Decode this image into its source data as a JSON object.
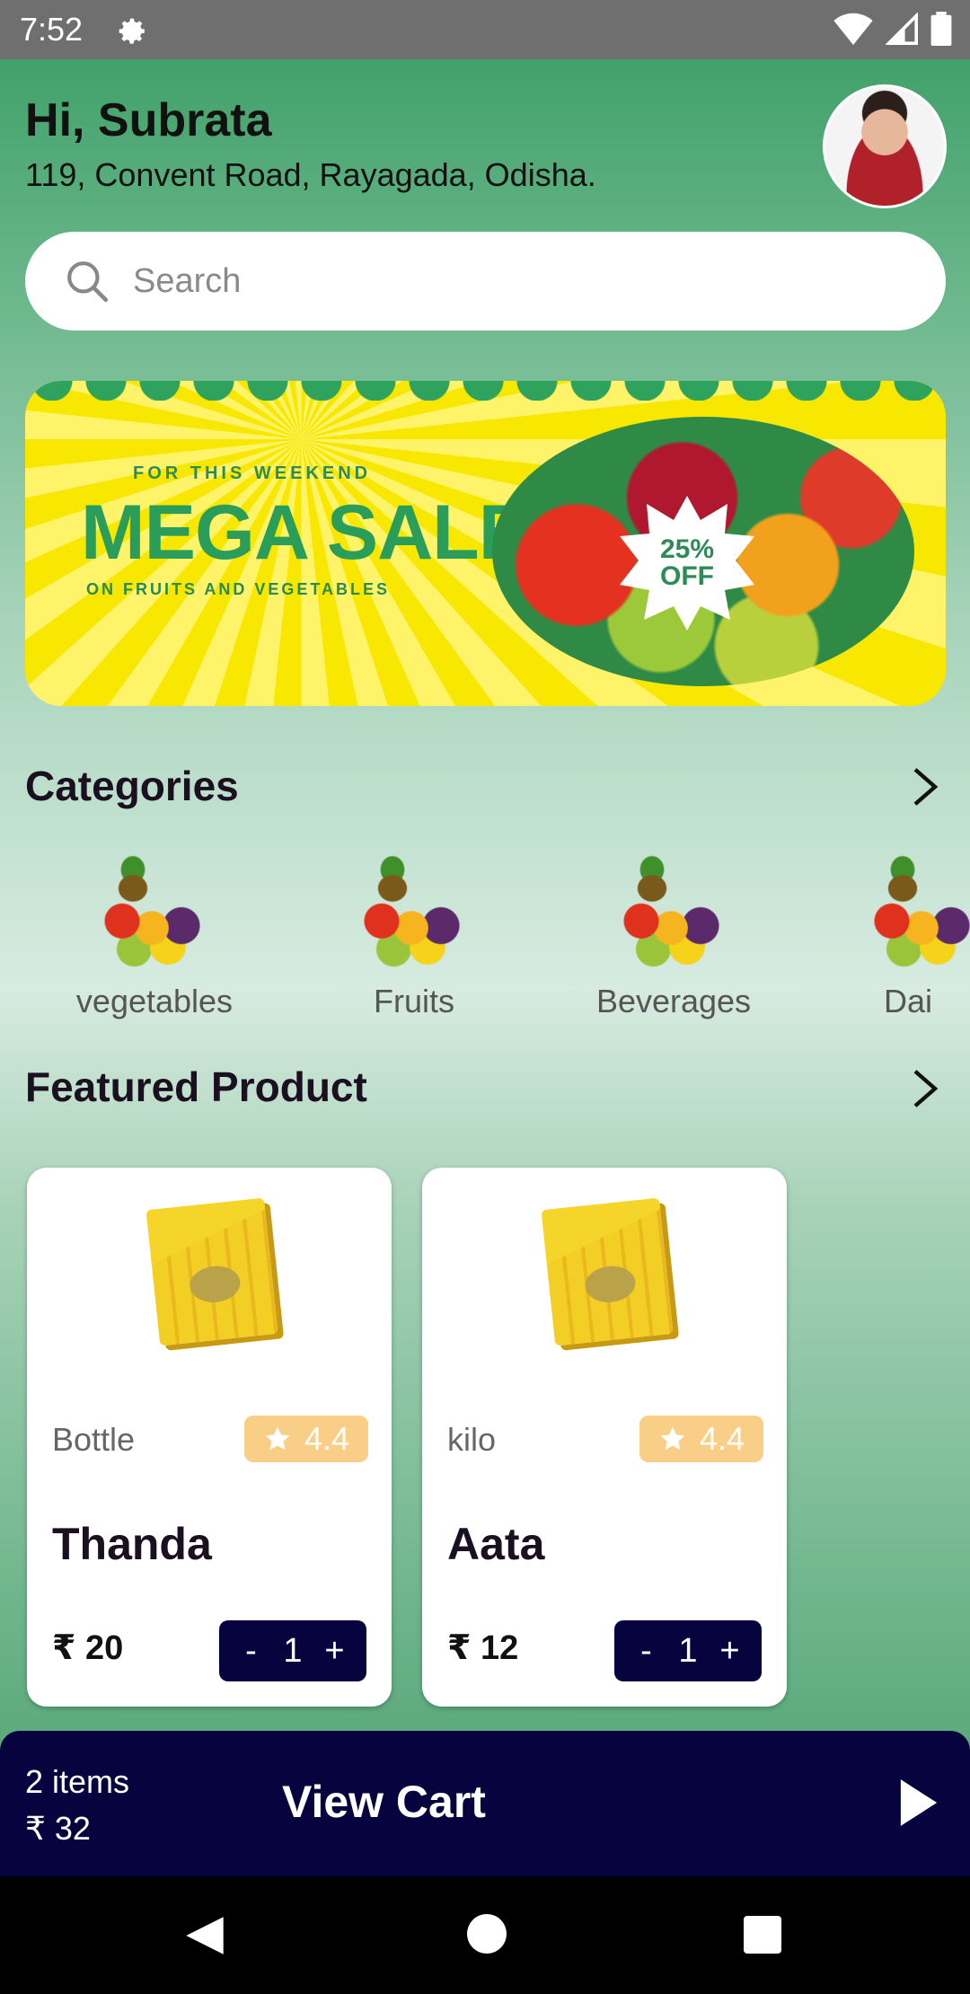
{
  "status_bar": {
    "time": "7:52"
  },
  "header": {
    "greeting": "Hi, Subrata",
    "address": "119, Convent Road, Rayagada, Odisha."
  },
  "search": {
    "placeholder": "Search",
    "value": ""
  },
  "banner": {
    "small_text": "FOR THIS WEEKEND",
    "title": "MEGA SALE!",
    "subtitle": "ON FRUITS AND VEGETABLES",
    "badge_line1": "25%",
    "badge_line2": "OFF"
  },
  "categories": {
    "title": "Categories",
    "items": [
      {
        "label": "vegetables"
      },
      {
        "label": "Fruits"
      },
      {
        "label": "Beverages"
      },
      {
        "label": "Dai"
      }
    ]
  },
  "featured": {
    "title": "Featured Product",
    "products": [
      {
        "unit": "Bottle",
        "rating": "4.4",
        "name": "Thanda",
        "price": "₹ 20",
        "qty": "1",
        "minus": "-",
        "plus": "+"
      },
      {
        "unit": "kilo",
        "rating": "4.4",
        "name": "Aata",
        "price": "₹ 12",
        "qty": "1",
        "minus": "-",
        "plus": "+"
      }
    ]
  },
  "cart": {
    "items": "2 items",
    "total": "₹ 32",
    "title": "View Cart"
  },
  "colors": {
    "accent": "#07033f",
    "rating_bg": "#f9cf87",
    "brand_green": "#379c61"
  }
}
